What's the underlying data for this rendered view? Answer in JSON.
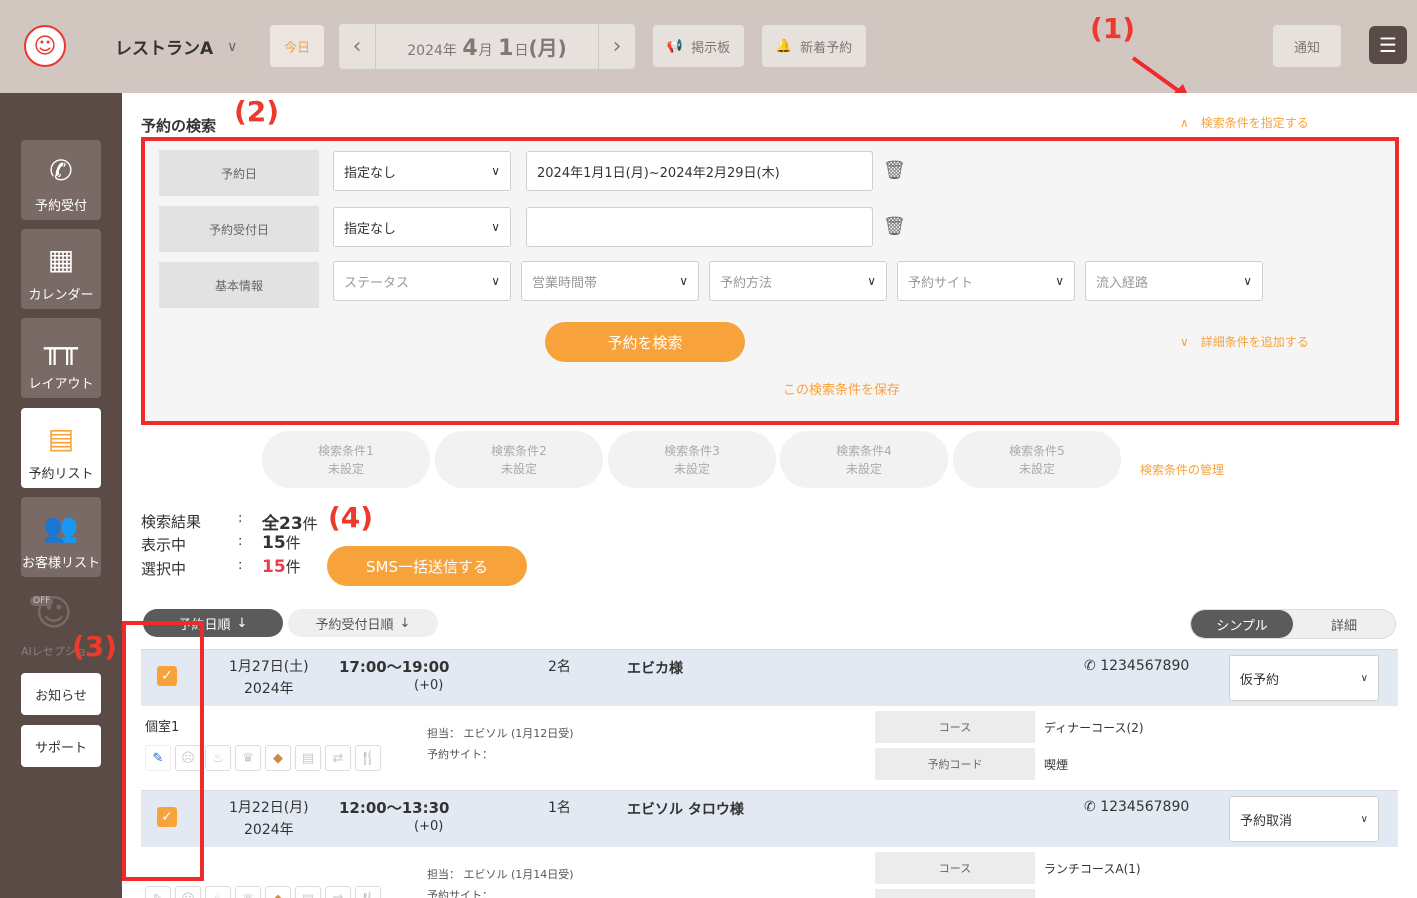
{
  "header": {
    "restaurant_name": "レストランA",
    "today_label": "今日",
    "date": {
      "year": "2024",
      "year_unit": "年",
      "month": "4",
      "month_unit": "月",
      "day": "1",
      "day_unit": "日",
      "weekday": "(月)"
    },
    "board_label": "掲示板",
    "new_reservation_label": "新着予約",
    "notification_label": "通知"
  },
  "annotations": {
    "a1": "(1)",
    "a2": "(2)",
    "a3": "(3)",
    "a4": "(4)"
  },
  "sidebar": {
    "items": [
      {
        "label": "予約受付",
        "icon": "phone-icon"
      },
      {
        "label": "カレンダー",
        "icon": "calendar-icon"
      },
      {
        "label": "レイアウト",
        "icon": "layout-icon"
      },
      {
        "label": "予約リスト",
        "icon": "book-icon"
      },
      {
        "label": "お客様リスト",
        "icon": "customers-icon"
      }
    ],
    "ai_label": "AIレセプショ",
    "ai_off": "OFF",
    "news_label": "お知らせ",
    "support_label": "サポート"
  },
  "search": {
    "title": "予約の検索",
    "toggle_link": "検索条件を指定する",
    "reservation_date_label": "予約日",
    "reservation_date_select": "指定なし",
    "reservation_date_range": "2024年1月1日(月)~2024年2月29日(木)",
    "received_date_label": "予約受付日",
    "received_date_select": "指定なし",
    "received_date_range": "",
    "basic_info_label": "基本情報",
    "filters": [
      "ステータス",
      "営業時間帯",
      "予約方法",
      "予約サイト",
      "流入経路"
    ],
    "add_detail_link": "詳細条件を追加する",
    "search_button": "予約を検索",
    "save_link": "この検索条件を保存",
    "saved": [
      {
        "name": "検索条件1",
        "state": "未設定"
      },
      {
        "name": "検索条件2",
        "state": "未設定"
      },
      {
        "name": "検索条件3",
        "state": "未設定"
      },
      {
        "name": "検索条件4",
        "state": "未設定"
      },
      {
        "name": "検索条件5",
        "state": "未設定"
      }
    ],
    "manage_link": "検索条件の管理"
  },
  "results": {
    "total_label": "検索結果",
    "total_prefix": "全",
    "total_value": "23",
    "shown_label": "表示中",
    "shown_value": "15",
    "selected_label": "選択中",
    "selected_value": "15",
    "unit": "件",
    "colon": ":",
    "sms_button": "SMS一括送信する",
    "sort_by_date": "予約日順",
    "sort_by_received": "予約受付日順",
    "view_simple": "シンプル",
    "view_detail": "詳細"
  },
  "reservations": [
    {
      "date": "1月27日(土)",
      "year": "2024年",
      "time": "17:00〜19:00",
      "offset": "(+0)",
      "people": "2名",
      "name": "エビカ様",
      "tel": "1234567890",
      "status": "仮予約",
      "room": "個室1",
      "staff_label": "担当：",
      "staff": "エビソル (1月12日受)",
      "site_label": "予約サイト：",
      "course_label": "コース",
      "course": "ディナーコース(2)",
      "code_label": "予約コード",
      "code": "喫煙"
    },
    {
      "date": "1月22日(月)",
      "year": "2024年",
      "time": "12:00〜13:30",
      "offset": "(+0)",
      "people": "1名",
      "name": "エビソル タロウ様",
      "tel": "1234567890",
      "status": "予約取消",
      "room": "",
      "staff_label": "担当：",
      "staff": "エビソル (1月14日受)",
      "site_label": "予約サイト：",
      "course_label": "コース",
      "course": "ランチコースA(1)"
    }
  ],
  "colors": {
    "accent": "#f7a23b",
    "sidebar": "#5b4b47",
    "header": "#d2c6c1",
    "annotation": "#ee2a2a",
    "row_bg": "#e2e9f2"
  }
}
